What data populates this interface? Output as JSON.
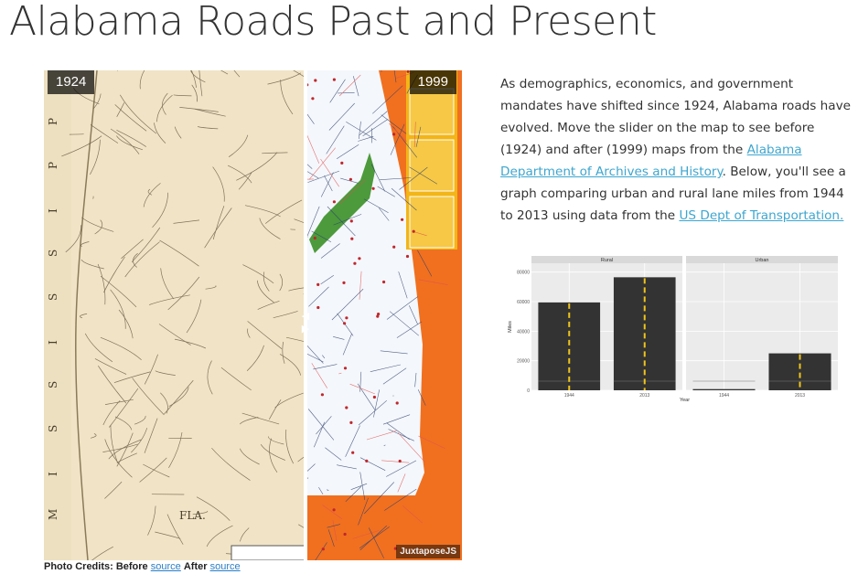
{
  "page": {
    "title": "Alabama Roads Past and Present"
  },
  "slider": {
    "before_label": "1924",
    "after_label": "1999",
    "credit": "JuxtaposeJS",
    "split_percent": 62.6,
    "map_text_before": {
      "state_column": [
        "P",
        "P",
        "I",
        "S",
        "S",
        "I",
        "S",
        "S",
        "I",
        "M"
      ],
      "region_label": "FLA."
    }
  },
  "credits": {
    "prefix": "Photo Credits: Before",
    "before_link": "source",
    "middle": "After",
    "after_link": "source"
  },
  "description": {
    "part1": "As demographics, economics, and government mandates have shifted since 1924, Alabama roads have evolved. Move the slider on the map to see before (1924) and after (1999) maps from the ",
    "link1": "Alabama Department of Archives and History",
    "part2": ". Below, you'll see a graph comparing urban and rural lane miles from 1944 to 2013 using data from the ",
    "link2": "US Dept of Transportation."
  },
  "colors": {
    "bar": "#333333",
    "stripe": "#f0c419",
    "panel_bg": "#ebebeb",
    "strip_bg": "#d9d9d9",
    "link": "#3ea6cf",
    "map_paper": "#f1e4c6",
    "map_orange": "#f07020",
    "map_water": "#cfe6f4"
  },
  "chart_data": {
    "type": "bar",
    "facets": [
      "Rural",
      "Urban"
    ],
    "categories": [
      "1944",
      "2013"
    ],
    "series": [
      {
        "facet": "Rural",
        "values": [
          59500,
          76500
        ]
      },
      {
        "facet": "Urban",
        "values": [
          800,
          25000
        ]
      }
    ],
    "ylabel": "Miles",
    "xlabel": "Year",
    "ylim": [
      0,
      86000
    ],
    "yticks": [
      "0",
      "20000",
      "40000",
      "60000",
      "80000"
    ],
    "grid": true
  }
}
